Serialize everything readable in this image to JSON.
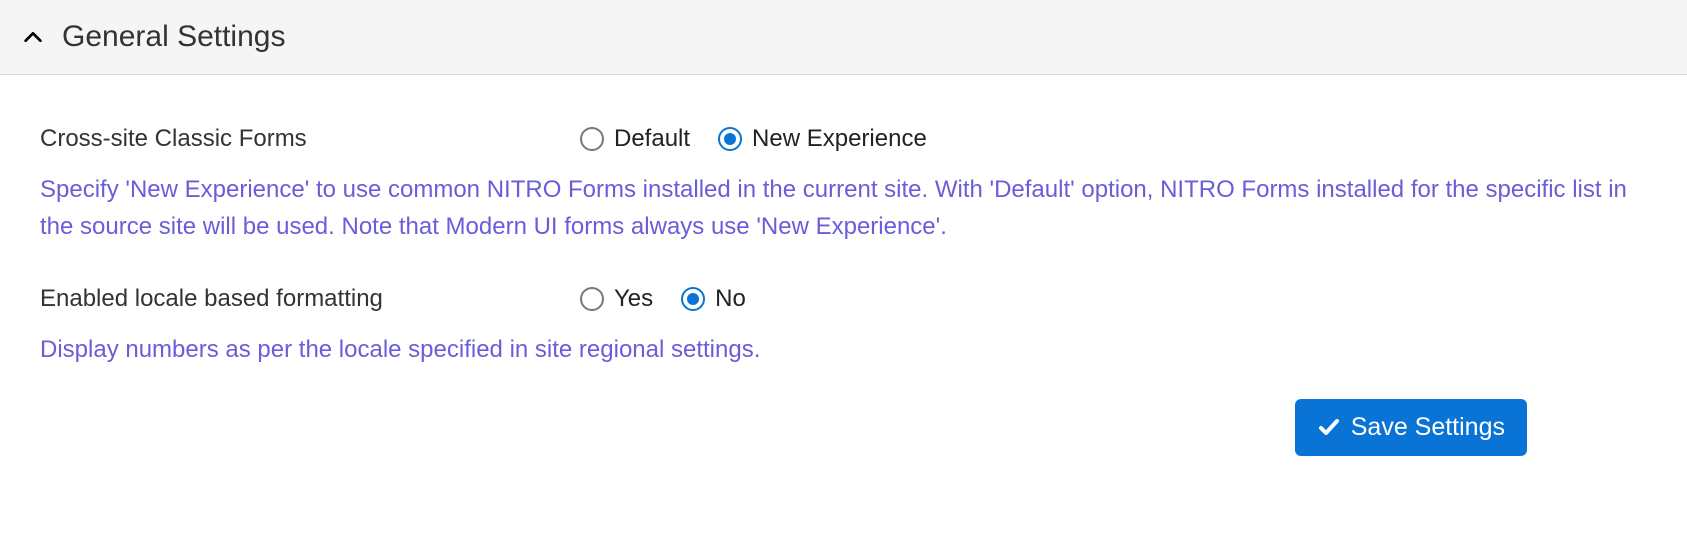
{
  "panel": {
    "title": "General Settings"
  },
  "settings": {
    "crossSite": {
      "label": "Cross-site Classic Forms",
      "options": {
        "default": "Default",
        "newExperience": "New Experience"
      },
      "selected": "newExperience",
      "help": "Specify 'New Experience' to use common NITRO Forms installed in the current site. With 'Default' option, NITRO Forms installed for the specific list in the source site will be used. Note that Modern UI forms always use 'New Experience'."
    },
    "localeFormatting": {
      "label": "Enabled locale based formatting",
      "options": {
        "yes": "Yes",
        "no": "No"
      },
      "selected": "no",
      "help": "Display numbers as per the locale specified in site regional settings."
    }
  },
  "buttons": {
    "save": "Save Settings"
  }
}
